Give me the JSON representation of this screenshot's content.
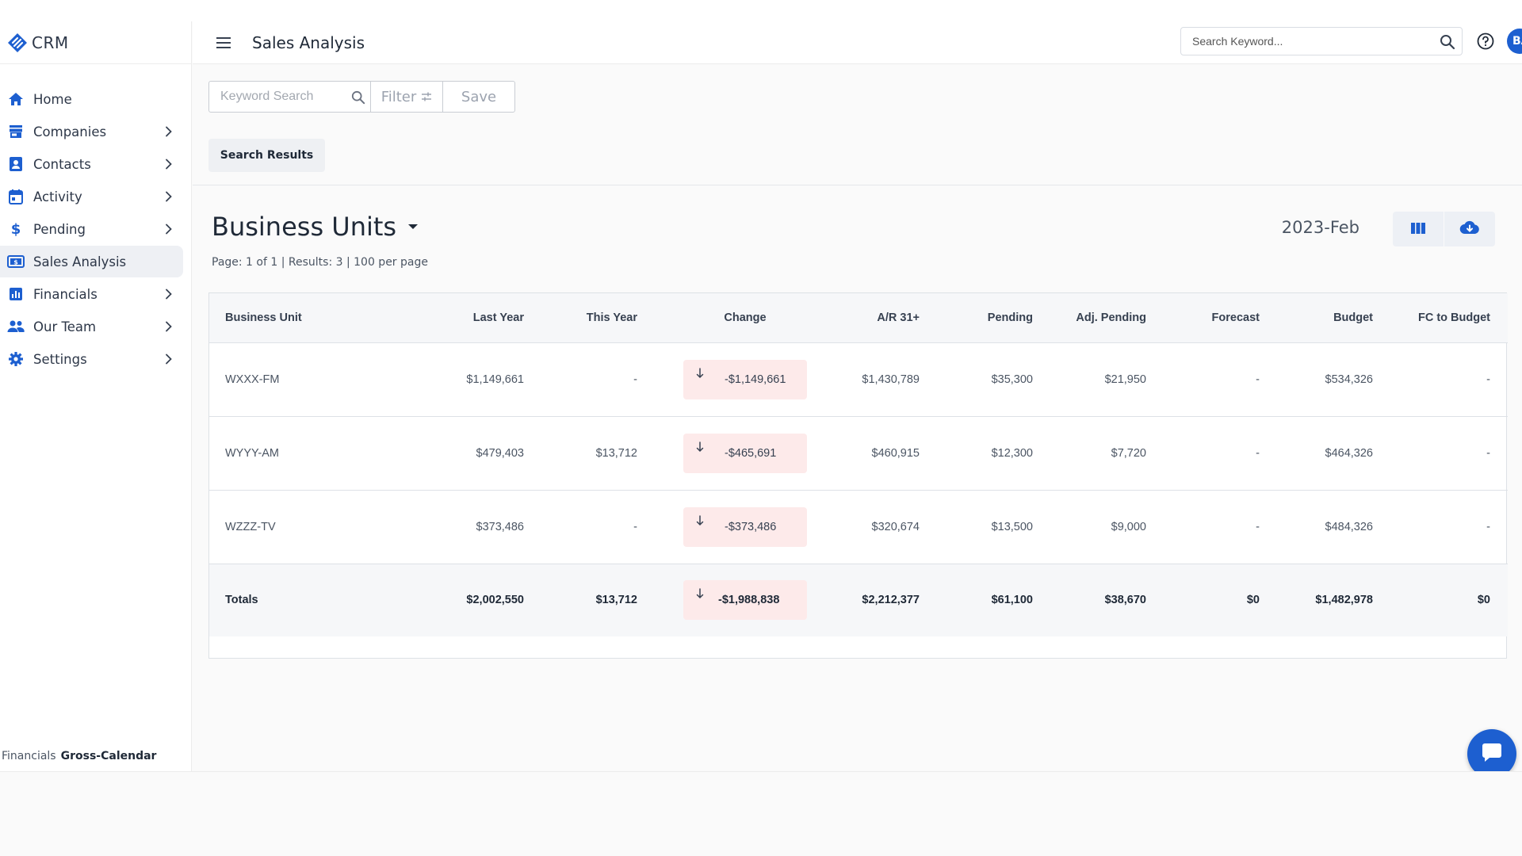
{
  "brand": {
    "name": "CRM"
  },
  "sidebar": {
    "items": [
      {
        "label": "Home",
        "icon": "home-icon",
        "has_chevron": false,
        "active": false
      },
      {
        "label": "Companies",
        "icon": "store-icon",
        "has_chevron": true,
        "active": false
      },
      {
        "label": "Contacts",
        "icon": "contact-card-icon",
        "has_chevron": true,
        "active": false
      },
      {
        "label": "Activity",
        "icon": "calendar-icon",
        "has_chevron": true,
        "active": false
      },
      {
        "label": "Pending",
        "icon": "dollar-icon",
        "has_chevron": true,
        "active": false
      },
      {
        "label": "Sales Analysis",
        "icon": "money-icon",
        "has_chevron": false,
        "active": true
      },
      {
        "label": "Financials",
        "icon": "bar-chart-icon",
        "has_chevron": true,
        "active": false
      },
      {
        "label": "Our Team",
        "icon": "people-icon",
        "has_chevron": true,
        "active": false
      },
      {
        "label": "Settings",
        "icon": "gear-icon",
        "has_chevron": true,
        "active": false
      }
    ],
    "footer": {
      "section": "Financials",
      "mode": "Gross-Calendar"
    }
  },
  "header": {
    "title": "Sales Analysis",
    "search_placeholder": "Search Keyword...",
    "avatar_initials": "BA"
  },
  "toolbar": {
    "keyword_placeholder": "Keyword Search",
    "filter_label": "Filter",
    "save_label": "Save"
  },
  "tabs": {
    "search_results": "Search Results"
  },
  "section": {
    "title": "Business Units",
    "page_info": "Page: 1 of 1  | Results: 3 | 100 per page",
    "period": "2023-Feb"
  },
  "colors": {
    "accent": "#1d5fd0",
    "change_negative_bg": "#fdeaea"
  },
  "table": {
    "columns": [
      "Business Unit",
      "Last Year",
      "This Year",
      "Change",
      "A/R 31+",
      "Pending",
      "Adj. Pending",
      "Forecast",
      "Budget",
      "FC to Budget"
    ],
    "rows": [
      {
        "unit": "WXXX-FM",
        "last_year": "$1,149,661",
        "this_year": "-",
        "change": "-$1,149,661",
        "ar31": "$1,430,789",
        "pending": "$35,300",
        "adj_pending": "$21,950",
        "forecast": "-",
        "budget": "$534,326",
        "fc_to_budget": "-"
      },
      {
        "unit": "WYYY-AM",
        "last_year": "$479,403",
        "this_year": "$13,712",
        "change": "-$465,691",
        "ar31": "$460,915",
        "pending": "$12,300",
        "adj_pending": "$7,720",
        "forecast": "-",
        "budget": "$464,326",
        "fc_to_budget": "-"
      },
      {
        "unit": "WZZZ-TV",
        "last_year": "$373,486",
        "this_year": "-",
        "change": "-$373,486",
        "ar31": "$320,674",
        "pending": "$13,500",
        "adj_pending": "$9,000",
        "forecast": "-",
        "budget": "$484,326",
        "fc_to_budget": "-"
      }
    ],
    "totals": {
      "unit": "Totals",
      "last_year": "$2,002,550",
      "this_year": "$13,712",
      "change": "-$1,988,838",
      "ar31": "$2,212,377",
      "pending": "$61,100",
      "adj_pending": "$38,670",
      "forecast": "$0",
      "budget": "$1,482,978",
      "fc_to_budget": "$0"
    }
  }
}
